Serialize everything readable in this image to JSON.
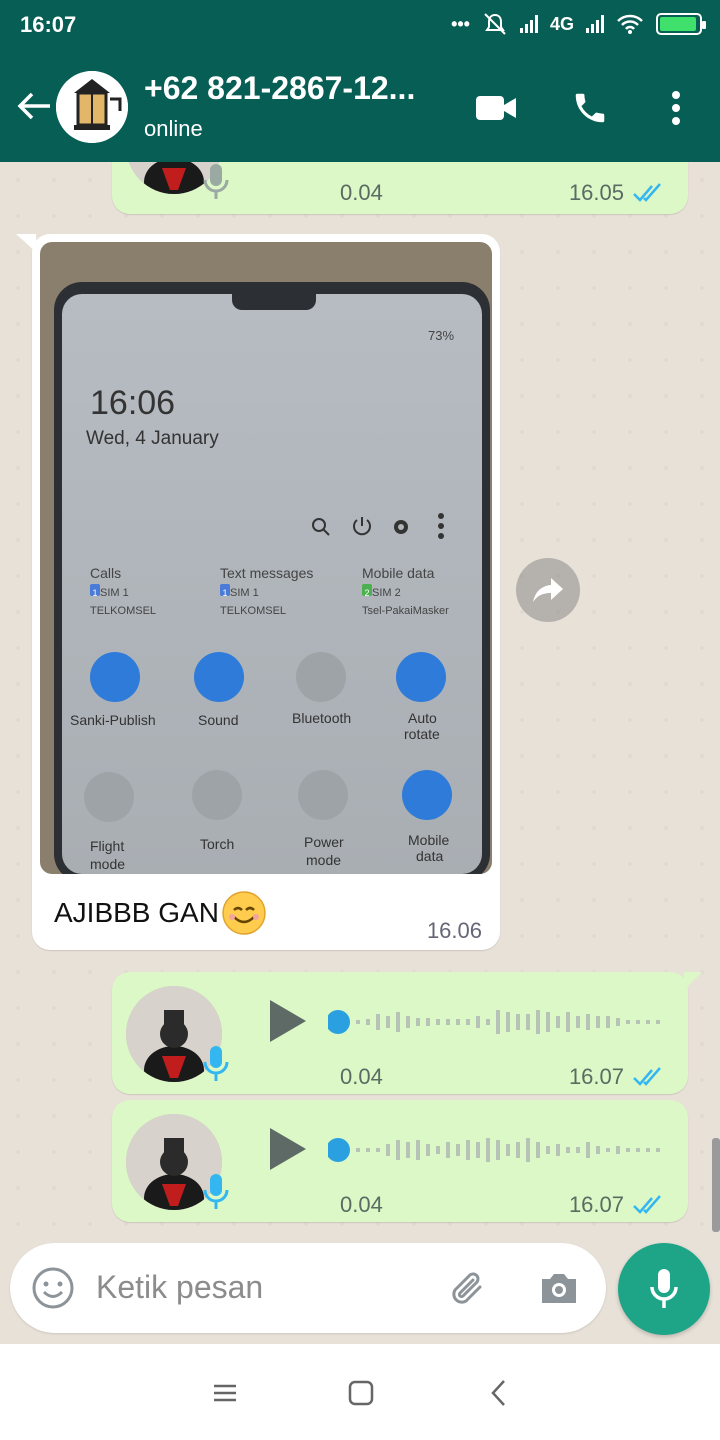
{
  "status_bar": {
    "time": "16:07",
    "network": "4G",
    "network_sub": "⁺ᴵᴵ",
    "dots": "•••"
  },
  "header": {
    "contact": "+62 821-2867-12...",
    "status": "online",
    "colors": {
      "primary": "#075e54",
      "accent": "#1ea588",
      "bubble_out": "#dcf8c6",
      "tick": "#34b7f1"
    }
  },
  "messages": [
    {
      "type": "voice",
      "direction": "out",
      "duration": "0.04",
      "time": "16.05",
      "read": true,
      "played": true
    },
    {
      "type": "image",
      "direction": "in",
      "caption": "AJIBBB GAN",
      "caption_emoji": "smiling-face-icon",
      "time": "16.06",
      "photo": {
        "status": "73%",
        "clock": "16:06",
        "date": "Wed, 4 January",
        "sims": [
          {
            "label": "Calls",
            "sim": "SIM 1",
            "carrier": "TELKOMSEL",
            "badge": "1",
            "color": "#4a7bd6"
          },
          {
            "label": "Text messages",
            "sim": "SIM 1",
            "carrier": "TELKOMSEL",
            "badge": "1",
            "color": "#4a7bd6"
          },
          {
            "label": "Mobile data",
            "sim": "SIM 2",
            "carrier": "Tsel-PakaiMasker",
            "badge": "2",
            "color": "#4caf50"
          }
        ],
        "tiles_row1": [
          {
            "label": "Sanki-Publish",
            "label2": "",
            "icon": "wifi-icon",
            "on": true
          },
          {
            "label": "Sound",
            "label2": "",
            "icon": "speaker-icon",
            "on": true
          },
          {
            "label": "Bluetooth",
            "label2": "",
            "icon": "bluetooth-icon",
            "on": false
          },
          {
            "label": "Auto",
            "label2": "rotate",
            "icon": "rotate-icon",
            "on": true
          }
        ],
        "tiles_row2": [
          {
            "label": "Flight",
            "label2": "mode",
            "icon": "airplane-icon",
            "on": false
          },
          {
            "label": "Torch",
            "label2": "",
            "icon": "torch-icon",
            "on": false
          },
          {
            "label": "Power",
            "label2": "mode",
            "icon": "battery-icon",
            "on": false
          },
          {
            "label": "Mobile",
            "label2": "data",
            "icon": "data-icon",
            "on": true
          }
        ]
      }
    },
    {
      "type": "voice",
      "direction": "out",
      "duration": "0.04",
      "time": "16.07",
      "read": true,
      "played": false
    },
    {
      "type": "voice",
      "direction": "out",
      "duration": "0.04",
      "time": "16.07",
      "read": true,
      "played": false
    }
  ],
  "input": {
    "placeholder": "Ketik pesan"
  }
}
